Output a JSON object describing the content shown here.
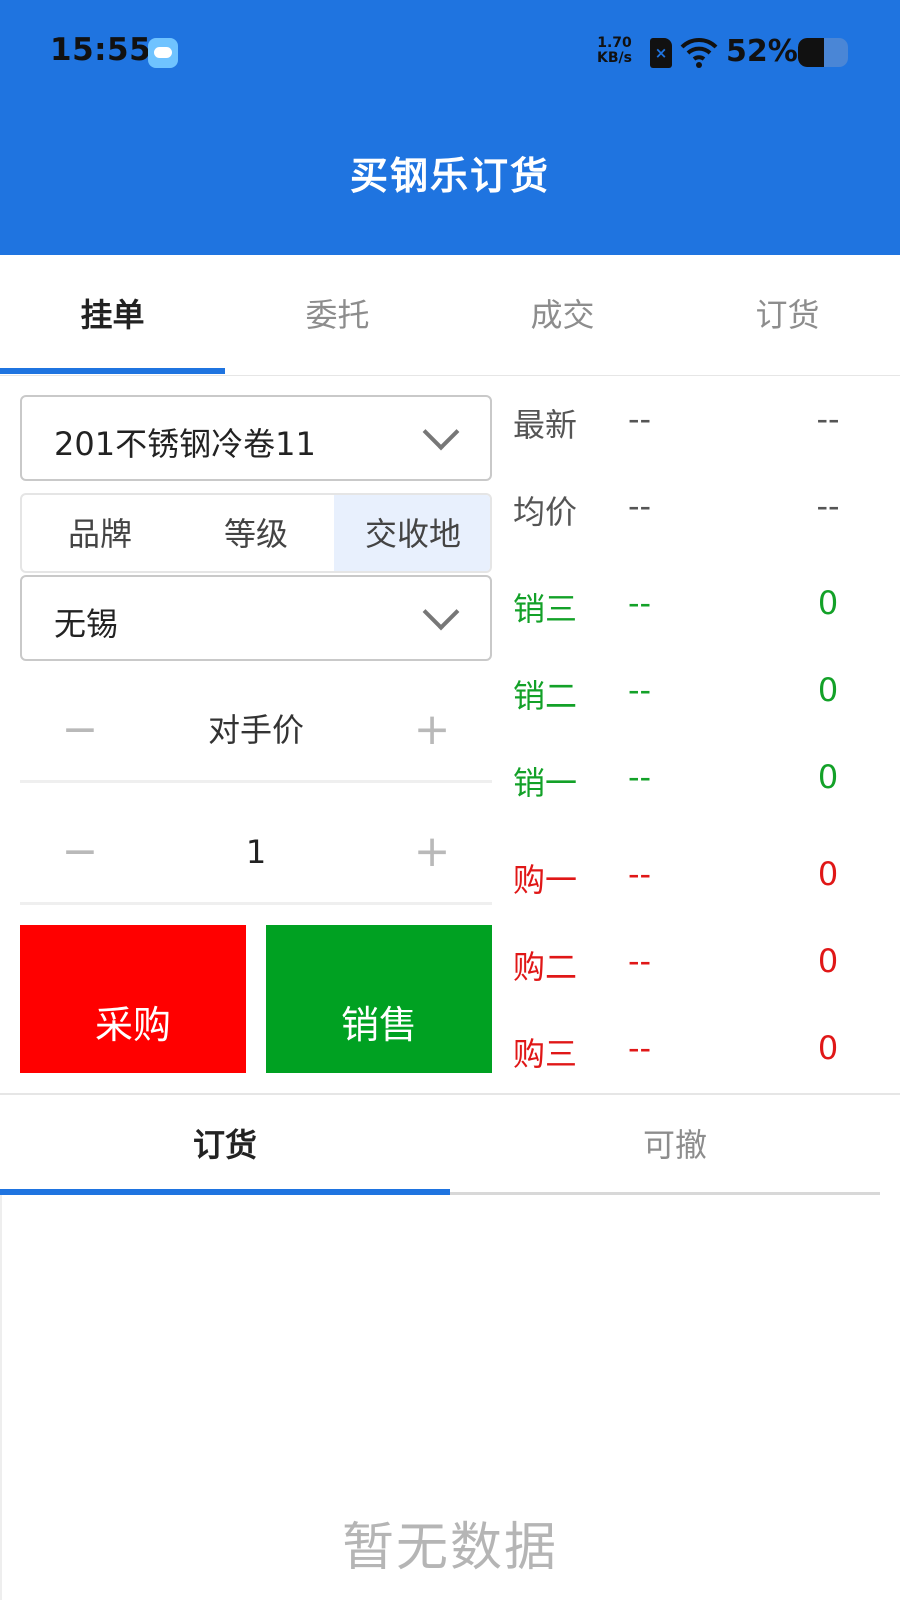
{
  "status_bar": {
    "time": "15:55",
    "net_speed_value": "1.70",
    "net_speed_unit": "KB/s",
    "sim_icon_glyph": "×",
    "battery_percent": "52%",
    "battery_level": 0.52
  },
  "app": {
    "title": "买钢乐订货",
    "accent_color": "#1f74e0"
  },
  "top_tabs": [
    {
      "label": "挂单",
      "active": true
    },
    {
      "label": "委托",
      "active": false
    },
    {
      "label": "成交",
      "active": false
    },
    {
      "label": "订货",
      "active": false
    }
  ],
  "order_form": {
    "product_select": "201不锈钢冷卷11",
    "filter_segments": [
      {
        "label": "品牌",
        "active": false
      },
      {
        "label": "等级",
        "active": false
      },
      {
        "label": "交收地",
        "active": true
      }
    ],
    "location_select": "无锡",
    "price_stepper": {
      "minus": "−",
      "value": "对手价",
      "plus": "+"
    },
    "quantity_stepper": {
      "minus": "−",
      "value": "1",
      "plus": "+"
    },
    "buy_label": "采购",
    "sell_label": "销售"
  },
  "quotes": [
    {
      "label": "最新",
      "price": "--",
      "volume": "--",
      "color": "gray"
    },
    {
      "label": "均价",
      "price": "--",
      "volume": "--",
      "color": "gray"
    },
    {
      "label": "销三",
      "price": "--",
      "volume": "0",
      "color": "green"
    },
    {
      "label": "销二",
      "price": "--",
      "volume": "0",
      "color": "green"
    },
    {
      "label": "销一",
      "price": "--",
      "volume": "0",
      "color": "green"
    },
    {
      "label": "购一",
      "price": "--",
      "volume": "0",
      "color": "red"
    },
    {
      "label": "购二",
      "price": "--",
      "volume": "0",
      "color": "red"
    },
    {
      "label": "购三",
      "price": "--",
      "volume": "0",
      "color": "red"
    }
  ],
  "bottom_tabs": [
    {
      "label": "订货",
      "active": true
    },
    {
      "label": "可撤",
      "active": false
    }
  ],
  "empty_state": "暂无数据"
}
